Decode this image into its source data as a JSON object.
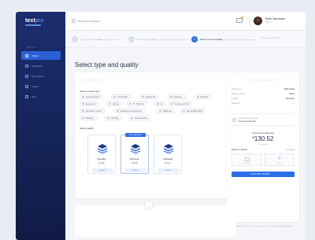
{
  "app": {
    "logo_main": "text",
    "logo_accent": "pro"
  },
  "sidebar": {
    "menu_label": "MENU",
    "items": [
      {
        "label": "Orders",
        "active": true
      },
      {
        "label": "Translators",
        "active": false
      },
      {
        "label": "Discussions",
        "active": false
      },
      {
        "label": "Profile",
        "active": false
      },
      {
        "label": "Help",
        "active": false
      }
    ]
  },
  "header": {
    "search_placeholder": "Search for translation",
    "user_name": "Robin Hernandez",
    "user_role": "Client"
  },
  "steps": [
    {
      "num": "1",
      "label": "Type or add a text file",
      "state": "done"
    },
    {
      "num": "2",
      "label": "Choose languages",
      "state": "done"
    },
    {
      "num": "3",
      "label": "Select type and quality",
      "state": "active"
    },
    {
      "num": "4",
      "label": "Order confirmation",
      "state": "todo"
    }
  ],
  "page": {
    "title": "Select type and quality",
    "step_ghost": "STEP 3"
  },
  "content_type": {
    "label": "Select content type",
    "chips": [
      "General Content",
      "Construction",
      "Engineering",
      "Enterprise",
      "Business",
      "Ecommerce",
      "Gaming",
      "IT / Technical",
      "Art",
      "Science and Tech",
      "Automotive Industry",
      "Emails & Correspondence",
      "Healthcare",
      "Web & Mobile Apps",
      "Marketing",
      "Gambling",
      "Student's Work"
    ]
  },
  "quality": {
    "label": "Select quality",
    "cards": [
      {
        "name": "Standard",
        "price": "$ 0.06",
        "select": "SELECT",
        "badge": ""
      },
      {
        "name": "Business",
        "price": "$ 0.09",
        "select": "SELECT",
        "badge": "RECOMMENDED"
      },
      {
        "name": "Individual",
        "price": "$ 0.12",
        "select": "SELECT",
        "badge": ""
      }
    ]
  },
  "order": {
    "title": "YOUR ORDER",
    "rows": [
      {
        "label": "Word count",
        "value": "1250 words"
      },
      {
        "label": "Price per word",
        "value": "$0.16"
      },
      {
        "label": "Quality",
        "value": "Business"
      },
      {
        "label": "English is",
        "value": "..."
      }
    ],
    "delivery_label": "Estimated delivery time",
    "delivery_value": "12 hrs and 30 mins",
    "total_label": "Your current total price",
    "total_currency": "$",
    "total_value": "130.52",
    "total_note": "Tax included",
    "payment_label": "Payment method",
    "payment_message": "Message",
    "payment_options": [
      "Credit card",
      "PayPal"
    ],
    "confirm_label": "CONFIRM ORDER",
    "terms": "By clicking 'Confirm Order', you agree to our Terms & Conditions and Quality Policy"
  },
  "colors": {
    "sidebar": "#142356",
    "accent": "#2b6fe8"
  }
}
